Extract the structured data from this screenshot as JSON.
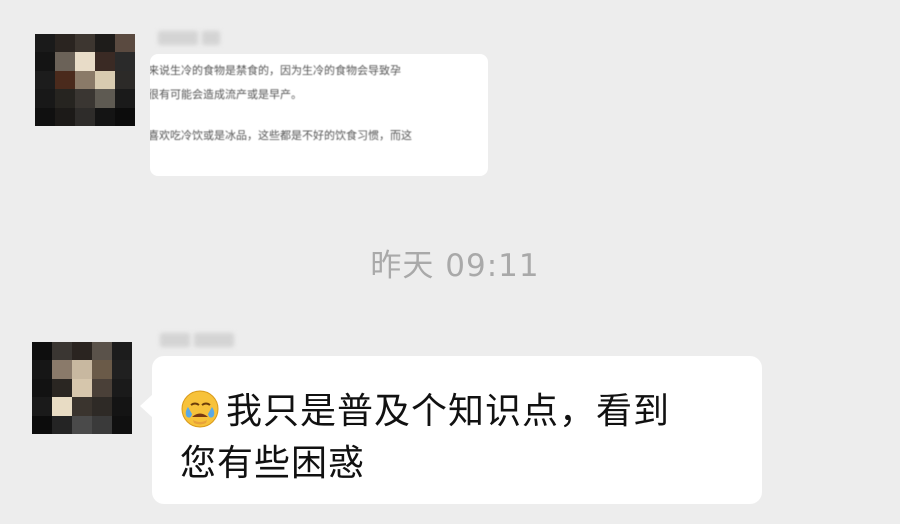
{
  "app": "WeChat chat",
  "messages": [
    {
      "type": "received",
      "lines": [
        "来说生冷的食物是禁食的，因为生冷的食物会导致孕",
        "很有可能会造成流产或是早产。",
        "喜欢吃冷饮或是冰品，这些都是不好的饮食习惯，而这"
      ]
    },
    {
      "type": "timestamp",
      "text": "昨天 09:11"
    },
    {
      "type": "received",
      "emoji": "crying-face-emoji",
      "text_line1": "我只是普及个知识点，看到",
      "text_line2": "您有些困惑"
    }
  ],
  "colors": {
    "background": "#ededed",
    "bubble": "#ffffff",
    "timestamp": "#a9a9a9",
    "text": "#111111"
  }
}
